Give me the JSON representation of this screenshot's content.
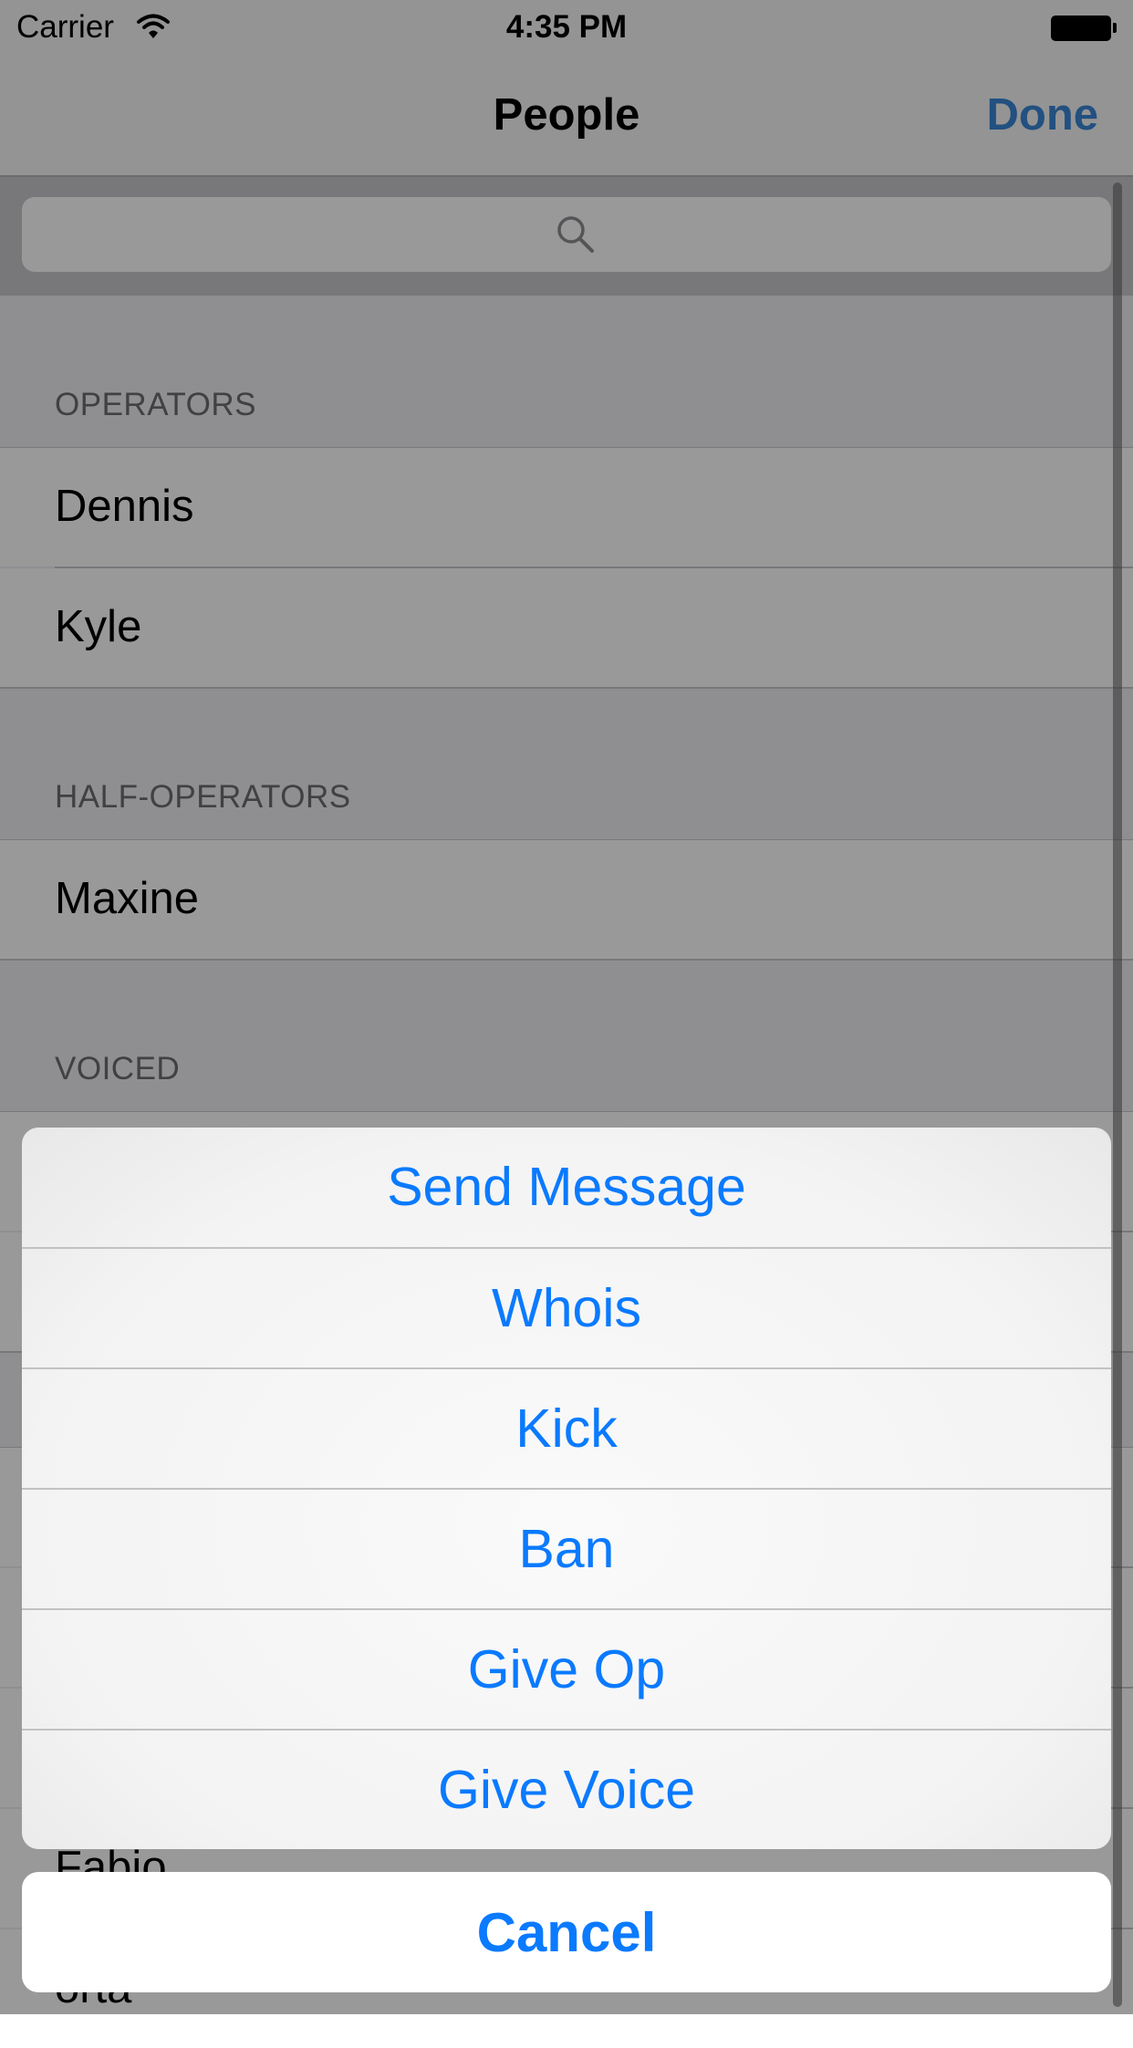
{
  "status_bar": {
    "carrier": "Carrier",
    "time": "4:35 PM"
  },
  "nav": {
    "title": "People",
    "done_label": "Done"
  },
  "search": {
    "placeholder": ""
  },
  "sections": [
    {
      "header": "OPERATORS",
      "rows": [
        "Dennis",
        "Kyle"
      ]
    },
    {
      "header": "HALF-OPERATORS",
      "rows": [
        "Maxine"
      ]
    },
    {
      "header": "VOICED",
      "rows": [
        "",
        ""
      ]
    },
    {
      "header": "",
      "rows": [
        "",
        "",
        "",
        "Fabio",
        "orta"
      ]
    }
  ],
  "action_sheet": {
    "actions": [
      "Send Message",
      "Whois",
      "Kick",
      "Ban",
      "Give Op",
      "Give Voice"
    ],
    "cancel_label": "Cancel"
  },
  "colors": {
    "accent": "#0a7aff",
    "nav_done": "#3a86d6",
    "dim": "rgba(0,0,0,0.40)"
  }
}
